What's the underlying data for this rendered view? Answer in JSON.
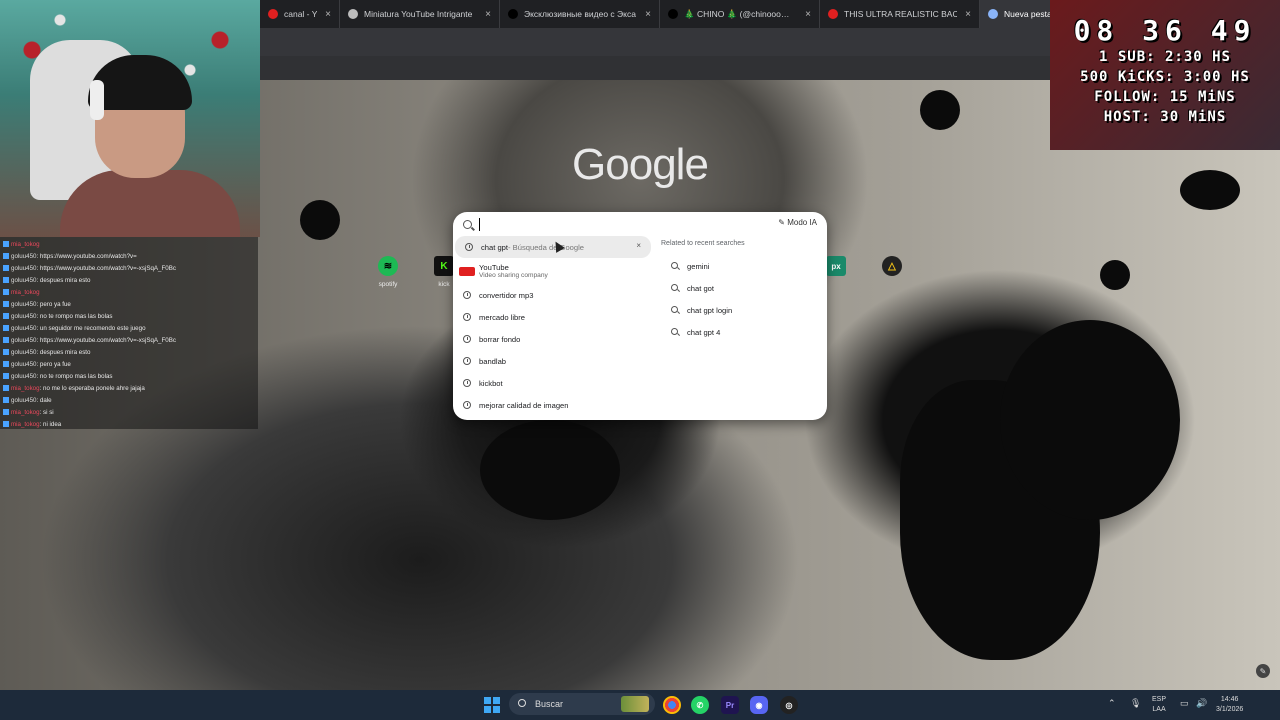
{
  "tabs": [
    {
      "label": "canal - YouTube",
      "color": "#e02020"
    },
    {
      "label": "Miniatura YouTube Intrigante",
      "color": "#bdbdbd"
    },
    {
      "label": "Эксклюзивные видео с Экса…",
      "color": "#000000"
    },
    {
      "label": "🎄 CHINO 🎄 (@chinooo…",
      "color": "#000000"
    },
    {
      "label": "THIS ULTRA REALISTIC BACKRO…",
      "color": "#e02020"
    },
    {
      "label": "Nueva pestaña",
      "color": "#8ab4f8"
    }
  ],
  "tab_close": "×",
  "timer": {
    "clock": "08 36 49",
    "lines": [
      "1 SUB: 2:30 HS",
      "500 KiCKS: 3:00 HS",
      "FOLLOW: 15 MiNS",
      "HOST: 30 MiNS"
    ]
  },
  "chat": [
    {
      "user": "mia_tokog",
      "text": "",
      "red": true
    },
    {
      "user": "goluu450",
      "text": ": https://www.youtube.com/watch?v=",
      "red": false
    },
    {
      "user": "goluu450",
      "text": ": https://www.youtube.com/watch?v=-xsjSqA_F0Bc",
      "red": false
    },
    {
      "user": "goluu450",
      "text": ": despues mira esto",
      "red": false
    },
    {
      "user": "mia_tokog",
      "text": "",
      "red": true
    },
    {
      "user": "goluu450",
      "text": ": pero ya fue",
      "red": false
    },
    {
      "user": "goluu450",
      "text": ": no te rompo mas las bolas",
      "red": false
    },
    {
      "user": "goluu450",
      "text": ": un seguidor me recomendo este juego",
      "red": false
    },
    {
      "user": "goluu450",
      "text": ": https://www.youtube.com/watch?v=-xsjSqA_F0Bc",
      "red": false
    },
    {
      "user": "goluu450",
      "text": ": despues mira esto",
      "red": false
    },
    {
      "user": "goluu450",
      "text": ": pero ya fue",
      "red": false
    },
    {
      "user": "goluu450",
      "text": ": no te rompo mas las bolas",
      "red": false
    },
    {
      "user": "mia_tokog",
      "text": ": no me lo esperaba ponele ahre jajaja",
      "red": true
    },
    {
      "user": "goluu450",
      "text": ": dale",
      "red": false
    },
    {
      "user": "mia_tokog",
      "text": ": si si",
      "red": true
    },
    {
      "user": "mia_tokog",
      "text": ": ni idea",
      "red": true
    }
  ],
  "google": {
    "logo": "Google"
  },
  "shortcuts": [
    {
      "label": "spotify",
      "glyph": "≋",
      "bg": "#1db954"
    },
    {
      "label": "kick",
      "glyph": "K",
      "bg": "#53fc18"
    },
    {
      "label": "",
      "glyph": "px",
      "bg": "#1a8a6a"
    },
    {
      "label": "",
      "glyph": "△",
      "bg": "#222222"
    }
  ],
  "search": {
    "modo_ia": "Modo IA",
    "suggestions": [
      {
        "text": "chat gpt",
        "detail": " - Búsqueda de Google",
        "selected": true
      },
      {
        "text": "convertidor mp3"
      },
      {
        "text": "mercado libre"
      },
      {
        "text": "borrar fondo"
      },
      {
        "text": "bandlab"
      },
      {
        "text": "kickbot"
      },
      {
        "text": "mejorar calidad de imagen"
      }
    ],
    "youtube": {
      "name": "YouTube",
      "sub": "Video sharing company"
    },
    "related_header": "Related to recent searches",
    "related": [
      "gemini",
      "chat got",
      "chat gpt login",
      "chat gpt 4"
    ],
    "remove": "×"
  },
  "taskbar": {
    "search_label": "Buscar",
    "lang_top": "ESP",
    "lang_bottom": "LAA",
    "time": "14:46",
    "date": "3/1/2026"
  }
}
